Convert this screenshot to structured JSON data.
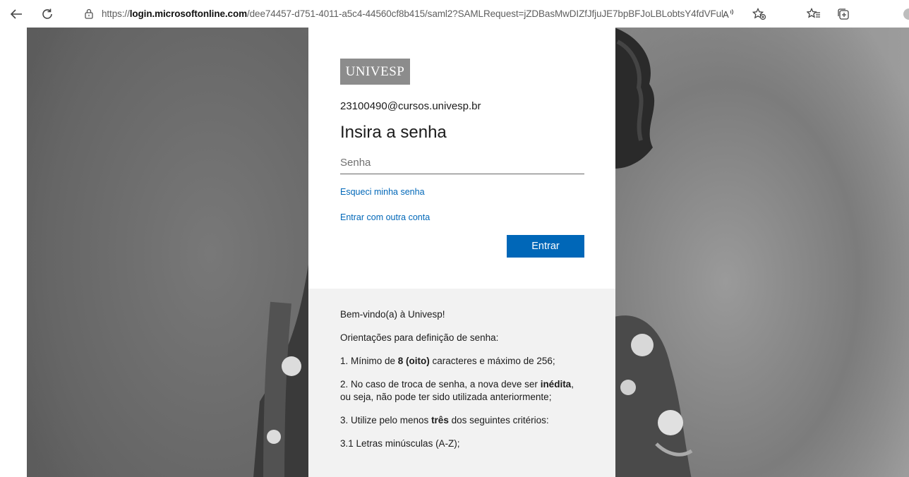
{
  "browser": {
    "url_prefix": "https://",
    "url_domain": "login.microsoftonline.com",
    "url_rest": "/dee74457-d751-4011-a5c4-44560cf8b415/saml2?SAMLRequest=jZDBasMwDIZfJfjuJE7bpBFJoLBLobtsY4fdVFulhsTJLK...",
    "icons": [
      "back-arrow-icon",
      "refresh-icon",
      "page-info-icon",
      "read-aloud-icon",
      "add-favorite-icon",
      "favorites-icon",
      "collections-icon",
      "profile-icon"
    ]
  },
  "card": {
    "logo_text_a": "UNI",
    "logo_text_v": "V",
    "logo_text_b": "ESP",
    "email": "23100490@cursos.univesp.br",
    "heading": "Insira a senha",
    "password_placeholder": "Senha",
    "password_value": "",
    "forgot_link": "Esqueci minha senha",
    "other_account_link": "Entrar com outra conta",
    "submit_label": "Entrar",
    "colors": {
      "accent": "#0067b8",
      "info_bg": "#f2f2f2"
    }
  },
  "info": {
    "welcome": "Bem-vindo(a) à Univesp!",
    "guidelines_title": "Orientações para definição de senha:",
    "rule1_pre": "1. Mínimo de ",
    "rule1_bold": "8 (oito)",
    "rule1_post": " caracteres e máximo de 256;",
    "rule2_pre": "2. No caso de troca de senha, a nova deve ser ",
    "rule2_bold": "inédita",
    "rule2_post": ", ou seja, não pode ter sido utilizada anteriormente;",
    "rule3_pre": "3. Utilize pelo menos ",
    "rule3_bold": "três",
    "rule3_post": " dos seguintes critérios:",
    "rule3_1": "3.1 Letras minúsculas (A-Z);"
  }
}
